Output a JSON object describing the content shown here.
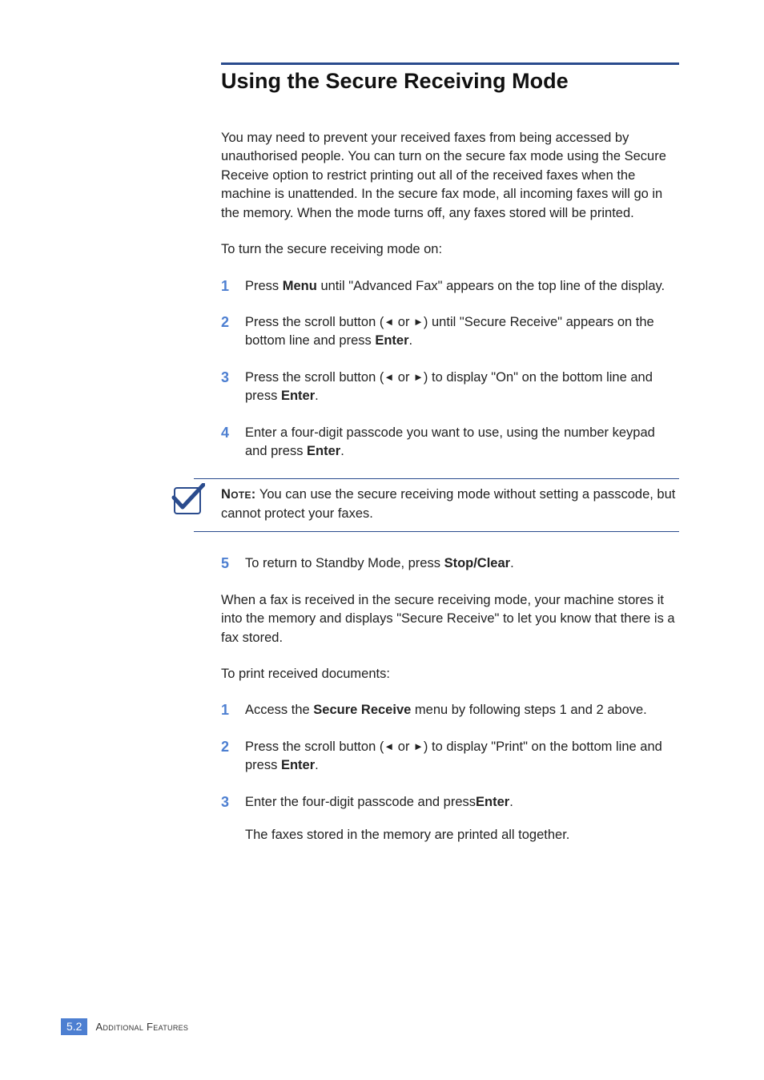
{
  "heading": "Using the Secure Receiving Mode",
  "intro": "You may need to prevent your received faxes from being accessed by unauthorised people. You can turn on the secure fax mode using the Secure Receive option to restrict printing out all of the received faxes when the machine is unattended. In the secure fax mode, all incoming faxes will go in the memory. When the mode turns off, any faxes stored will be printed.",
  "lead_in_1": "To turn the secure receiving mode on:",
  "steps_a": {
    "s1_a": "Press ",
    "s1_b": "Menu",
    "s1_c": " until \"Advanced Fax\" appears on the top line of the display.",
    "s2_a": "Press the scroll button (",
    "s2_b": " or ",
    "s2_c": ") until \"Secure Receive\" appears on the bottom line and press ",
    "s2_d": "Enter",
    "s2_e": ".",
    "s3_a": "Press the scroll button (",
    "s3_b": " or ",
    "s3_c": ") to display \"On\" on the bottom line and press ",
    "s3_d": "Enter",
    "s3_e": ".",
    "s4_a": "Enter a four-digit passcode you want to use, using the number keypad and press ",
    "s4_b": "Enter",
    "s4_c": "."
  },
  "note": {
    "label": "Note:",
    "text": " You can use the secure receiving mode without setting a passcode, but cannot protect your faxes."
  },
  "steps_a5": {
    "a": "To return to Standby Mode, press ",
    "b": "Stop/Clear",
    "c": "."
  },
  "para_after": "When a fax is received in the secure receiving mode, your machine stores it into the memory and displays \"Secure Receive\" to let you know that there is a fax stored.",
  "lead_in_2": "To print received documents:",
  "steps_b": {
    "s1_a": "Access the ",
    "s1_b": "Secure Receive",
    "s1_c": " menu by following steps 1 and 2 above.",
    "s2_a": "Press the scroll button (",
    "s2_b": " or ",
    "s2_c": ") to display \"Print\" on the bottom line and press ",
    "s2_d": "Enter",
    "s2_e": ".",
    "s3_a": "Enter the four-digit passcode and press",
    "s3_b": "Enter",
    "s3_c": ".",
    "s3_after": "The faxes stored in the memory are printed all together."
  },
  "nums": {
    "n1": "1",
    "n2": "2",
    "n3": "3",
    "n4": "4",
    "n5": "5"
  },
  "arrows": {
    "left": "◄",
    "right": "►"
  },
  "footer": {
    "badge": "5.2",
    "text": "Additional Features"
  }
}
